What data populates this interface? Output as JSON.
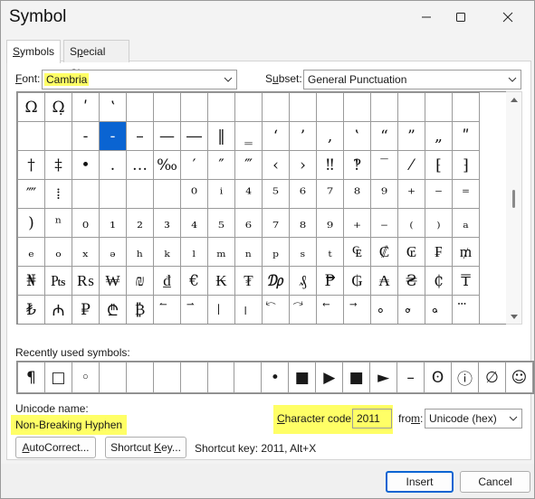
{
  "window": {
    "title": "Symbol",
    "minimize_icon": "minimize-icon",
    "maximize_icon": "maximize-icon",
    "close_icon": "close-icon"
  },
  "tabs": [
    {
      "label_pre": "",
      "label_u": "S",
      "label_post": "ymbols",
      "active": true
    },
    {
      "label_pre": "S",
      "label_u": "p",
      "label_post": "ecial Characters",
      "active": false
    }
  ],
  "font": {
    "label_pre": "",
    "label_u": "F",
    "label_post": "ont:",
    "value": "Cambria"
  },
  "subset": {
    "label_pre": "S",
    "label_u": "u",
    "label_post": "bset:",
    "value": "General Punctuation"
  },
  "symbol_grid": {
    "selected": {
      "row": 1,
      "col": 3
    },
    "rows": [
      [
        "Ω",
        "Ω̣",
        "ʹ",
        "ʽ",
        "",
        "",
        "",
        "",
        "",
        "",
        "",
        "",
        "",
        "",
        "",
        ""
      ],
      [
        "",
        "",
        "-",
        "‑",
        "–",
        "—",
        "―",
        "‖",
        "‗",
        "‘",
        "’",
        "‚",
        "‛",
        "“",
        "”",
        "„"
      ],
      [
        "†",
        "‡",
        "•",
        "․",
        "…",
        "‰",
        "′",
        "″",
        "‴",
        "‹",
        "›",
        "‼",
        "‽",
        "‾",
        "⁄",
        "⁅"
      ],
      [
        "⁗",
        "⁞",
        "",
        "",
        "",
        "",
        "⁰",
        "ⁱ",
        "⁴",
        "⁵",
        "⁶",
        "⁷",
        "⁸",
        "⁹",
        "⁺",
        "⁻"
      ],
      [
        ")",
        "ⁿ",
        "₀",
        "₁",
        "₂",
        "₃",
        "₄",
        "₅",
        "₆",
        "₇",
        "₈",
        "₉",
        "₊",
        "₋",
        "₍",
        "₎"
      ],
      [
        "ₑ",
        "ₒ",
        "ₓ",
        "ₔ",
        "ₕ",
        "ₖ",
        "ₗ",
        "ₘ",
        "ₙ",
        "ₚ",
        "ₛ",
        "ₜ",
        "₠",
        "₡",
        "₢",
        "₣"
      ],
      [
        "₦",
        "₧",
        "₨",
        "₩",
        "₪",
        "₫",
        "€",
        "₭",
        "₮",
        "₯",
        "₰",
        "₱",
        "₲",
        "₳",
        "₴",
        "₵"
      ],
      [
        "₺",
        "₼",
        "₽",
        "₾",
        "₿",
        "⃐",
        "⃑",
        "⃒",
        "⃓",
        "⃔",
        "⃕",
        "⃖",
        "⃗",
        "⃘",
        "⃙",
        "⃚"
      ]
    ],
    "extra_col": [
      "",
      "ʺ",
      "⁆",
      "⁼",
      "ₐ",
      "₥",
      "₸",
      "⃛"
    ]
  },
  "recent": {
    "label": "Recently used symbols:",
    "items": [
      "¶",
      "□",
      "◦",
      "",
      "",
      "",
      "",
      "",
      "",
      "•",
      "■",
      "▶",
      "■",
      "►",
      "–",
      "ʘ",
      "ⓘ",
      "∅",
      "☺"
    ]
  },
  "unicode_name": {
    "label": "Unicode name:",
    "value": "Non-Breaking Hyphen"
  },
  "char_code": {
    "label_pre": "",
    "label_u": "C",
    "label_post": "haracter code:",
    "value": "2011"
  },
  "from": {
    "label_pre": "fro",
    "label_u": "m",
    "label_post": ":",
    "value": "Unicode (hex)"
  },
  "buttons": {
    "autocorrect": {
      "pre": "",
      "u": "A",
      "post": "utoCorrect..."
    },
    "shortcut_key": {
      "pre": "Shortcut ",
      "u": "K",
      "post": "ey..."
    },
    "insert": "Insert",
    "cancel": "Cancel"
  },
  "shortcut_text": "Shortcut key: 2011, Alt+X",
  "colors": {
    "highlight": "#ffff66",
    "selection": "#0a64d2"
  }
}
